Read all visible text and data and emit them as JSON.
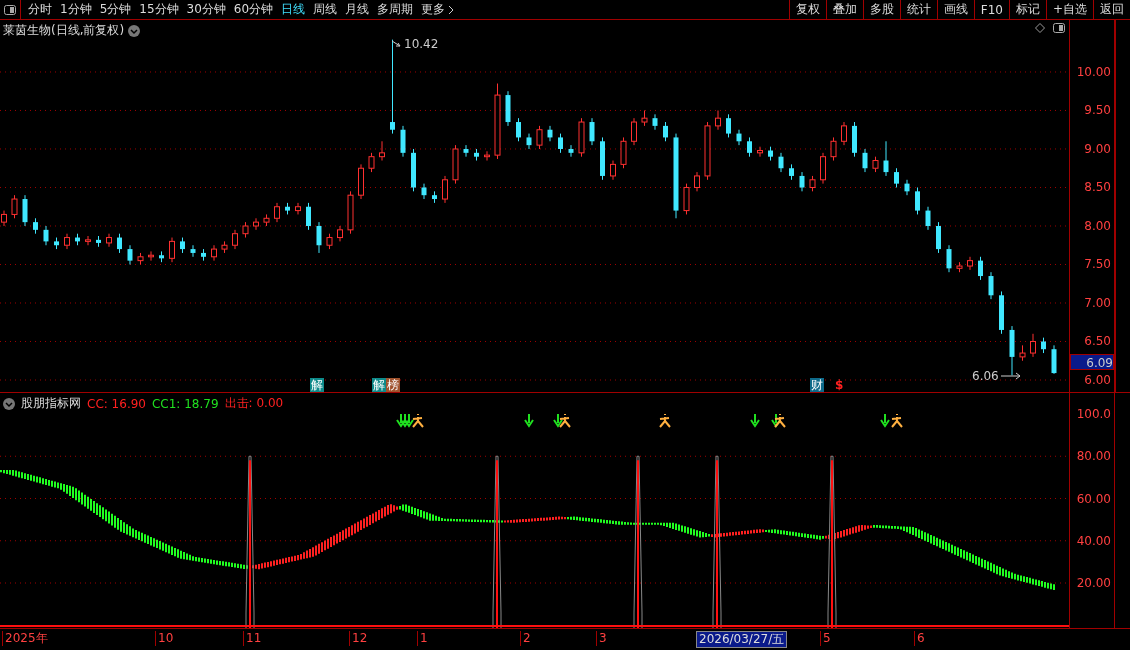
{
  "toolbar": {
    "periods": [
      {
        "label": "分时",
        "selected": false
      },
      {
        "label": "1分钟",
        "selected": false
      },
      {
        "label": "5分钟",
        "selected": false
      },
      {
        "label": "15分钟",
        "selected": false
      },
      {
        "label": "30分钟",
        "selected": false
      },
      {
        "label": "60分钟",
        "selected": false
      },
      {
        "label": "日线",
        "selected": true
      },
      {
        "label": "周线",
        "selected": false
      },
      {
        "label": "月线",
        "selected": false
      },
      {
        "label": "多周期",
        "selected": false
      },
      {
        "label": "更多",
        "selected": false
      }
    ],
    "actions": [
      "复权",
      "叠加",
      "多股",
      "统计",
      "画线",
      "F10",
      "标记",
      "+自选",
      "返回"
    ]
  },
  "main_chart": {
    "title": "莱茵生物(日线,前复权)",
    "high_label": "10.42",
    "low_label": "6.06",
    "last_price": "6.09",
    "chart_data": {
      "type": "candlestick",
      "grid": true,
      "ylim": [
        6,
        10.675
      ],
      "yticks": [
        {
          "value": 10,
          "label": "10.00"
        },
        {
          "value": 9.5,
          "label": "9.50"
        },
        {
          "value": 9,
          "label": "9.00"
        },
        {
          "value": 8.5,
          "label": "8.50"
        },
        {
          "value": 8,
          "label": "8.00"
        },
        {
          "value": 7.5,
          "label": "7.50"
        },
        {
          "value": 7,
          "label": "7.00"
        },
        {
          "value": 6.5,
          "label": "6.50"
        },
        {
          "value": 6,
          "label": "6.00"
        }
      ],
      "ohlc": [
        [
          8.05,
          8.2,
          8.0,
          8.15
        ],
        [
          8.15,
          8.4,
          8.1,
          8.35
        ],
        [
          8.35,
          8.4,
          8.0,
          8.05
        ],
        [
          8.05,
          8.1,
          7.9,
          7.95
        ],
        [
          7.95,
          8.0,
          7.75,
          7.8
        ],
        [
          7.8,
          7.85,
          7.7,
          7.75
        ],
        [
          7.75,
          7.9,
          7.7,
          7.85
        ],
        [
          7.85,
          7.9,
          7.75,
          7.8
        ],
        [
          7.8,
          7.87,
          7.75,
          7.82
        ],
        [
          7.82,
          7.87,
          7.73,
          7.78
        ],
        [
          7.78,
          7.9,
          7.73,
          7.85
        ],
        [
          7.85,
          7.9,
          7.65,
          7.7
        ],
        [
          7.7,
          7.75,
          7.5,
          7.55
        ],
        [
          7.55,
          7.65,
          7.5,
          7.6
        ],
        [
          7.6,
          7.67,
          7.55,
          7.62
        ],
        [
          7.62,
          7.67,
          7.53,
          7.58
        ],
        [
          7.58,
          7.85,
          7.53,
          7.8
        ],
        [
          7.8,
          7.85,
          7.65,
          7.7
        ],
        [
          7.7,
          7.75,
          7.6,
          7.65
        ],
        [
          7.65,
          7.7,
          7.55,
          7.6
        ],
        [
          7.6,
          7.75,
          7.55,
          7.7
        ],
        [
          7.7,
          7.8,
          7.65,
          7.75
        ],
        [
          7.75,
          7.95,
          7.7,
          7.9
        ],
        [
          7.9,
          8.05,
          7.85,
          8.0
        ],
        [
          8.0,
          8.1,
          7.95,
          8.05
        ],
        [
          8.05,
          8.15,
          8.0,
          8.1
        ],
        [
          8.1,
          8.3,
          8.05,
          8.25
        ],
        [
          8.25,
          8.3,
          8.15,
          8.2
        ],
        [
          8.2,
          8.3,
          8.15,
          8.25
        ],
        [
          8.25,
          8.3,
          7.95,
          8.0
        ],
        [
          8.0,
          8.05,
          7.65,
          7.75
        ],
        [
          7.75,
          7.9,
          7.7,
          7.85
        ],
        [
          7.85,
          8.0,
          7.8,
          7.95
        ],
        [
          7.95,
          8.45,
          7.9,
          8.4
        ],
        [
          8.4,
          8.8,
          8.35,
          8.75
        ],
        [
          8.75,
          8.95,
          8.7,
          8.9
        ],
        [
          8.9,
          9.1,
          8.85,
          8.95
        ],
        [
          9.35,
          10.42,
          9.2,
          9.25
        ],
        [
          9.25,
          9.3,
          8.9,
          8.95
        ],
        [
          8.95,
          9.0,
          8.45,
          8.5
        ],
        [
          8.5,
          8.55,
          8.35,
          8.4
        ],
        [
          8.4,
          8.45,
          8.3,
          8.35
        ],
        [
          8.35,
          8.65,
          8.3,
          8.6
        ],
        [
          8.6,
          9.05,
          8.55,
          9.0
        ],
        [
          9.0,
          9.05,
          8.9,
          8.95
        ],
        [
          8.95,
          9.0,
          8.85,
          8.9
        ],
        [
          8.9,
          8.97,
          8.85,
          8.92
        ],
        [
          8.92,
          9.85,
          8.87,
          9.7
        ],
        [
          9.7,
          9.75,
          9.3,
          9.35
        ],
        [
          9.35,
          9.4,
          9.1,
          9.15
        ],
        [
          9.15,
          9.2,
          9.0,
          9.05
        ],
        [
          9.05,
          9.3,
          9.0,
          9.25
        ],
        [
          9.25,
          9.3,
          9.1,
          9.15
        ],
        [
          9.15,
          9.2,
          8.95,
          9.0
        ],
        [
          9.0,
          9.05,
          8.9,
          8.95
        ],
        [
          8.95,
          9.4,
          8.9,
          9.35
        ],
        [
          9.35,
          9.4,
          9.05,
          9.1
        ],
        [
          9.1,
          9.15,
          8.6,
          8.65
        ],
        [
          8.65,
          8.85,
          8.6,
          8.8
        ],
        [
          8.8,
          9.15,
          8.75,
          9.1
        ],
        [
          9.1,
          9.4,
          9.05,
          9.35
        ],
        [
          9.35,
          9.5,
          9.3,
          9.4
        ],
        [
          9.4,
          9.45,
          9.25,
          9.3
        ],
        [
          9.3,
          9.35,
          9.1,
          9.15
        ],
        [
          9.15,
          9.2,
          8.1,
          8.2
        ],
        [
          8.2,
          8.55,
          8.15,
          8.5
        ],
        [
          8.5,
          8.7,
          8.45,
          8.65
        ],
        [
          8.65,
          9.35,
          8.6,
          9.3
        ],
        [
          9.3,
          9.5,
          9.25,
          9.4
        ],
        [
          9.4,
          9.45,
          9.15,
          9.2
        ],
        [
          9.2,
          9.25,
          9.05,
          9.1
        ],
        [
          9.1,
          9.15,
          8.9,
          8.95
        ],
        [
          8.95,
          9.03,
          8.9,
          8.98
        ],
        [
          8.98,
          9.03,
          8.85,
          8.9
        ],
        [
          8.9,
          8.95,
          8.7,
          8.75
        ],
        [
          8.75,
          8.8,
          8.6,
          8.65
        ],
        [
          8.65,
          8.7,
          8.45,
          8.5
        ],
        [
          8.5,
          8.65,
          8.45,
          8.6
        ],
        [
          8.6,
          8.95,
          8.55,
          8.9
        ],
        [
          8.9,
          9.15,
          8.85,
          9.1
        ],
        [
          9.1,
          9.35,
          9.05,
          9.3
        ],
        [
          9.3,
          9.35,
          8.9,
          8.95
        ],
        [
          8.95,
          9.0,
          8.7,
          8.75
        ],
        [
          8.75,
          8.9,
          8.7,
          8.85
        ],
        [
          8.85,
          9.1,
          8.65,
          8.7
        ],
        [
          8.7,
          8.75,
          8.5,
          8.55
        ],
        [
          8.55,
          8.6,
          8.4,
          8.45
        ],
        [
          8.45,
          8.5,
          8.15,
          8.2
        ],
        [
          8.2,
          8.25,
          7.95,
          8.0
        ],
        [
          8.0,
          8.05,
          7.65,
          7.7
        ],
        [
          7.7,
          7.75,
          7.4,
          7.45
        ],
        [
          7.45,
          7.53,
          7.4,
          7.48
        ],
        [
          7.48,
          7.6,
          7.43,
          7.55
        ],
        [
          7.55,
          7.6,
          7.3,
          7.35
        ],
        [
          7.35,
          7.4,
          7.05,
          7.1
        ],
        [
          7.1,
          7.15,
          6.6,
          6.65
        ],
        [
          6.65,
          6.7,
          6.06,
          6.3
        ],
        [
          6.3,
          6.45,
          6.25,
          6.35
        ],
        [
          6.35,
          6.6,
          6.3,
          6.5
        ],
        [
          6.5,
          6.55,
          6.35,
          6.4
        ],
        [
          6.4,
          6.45,
          6.08,
          6.09
        ]
      ]
    },
    "markers": [
      {
        "kind": "tag",
        "text": "解",
        "color": "#0e8a8a"
      },
      {
        "kind": "tag",
        "text": "解",
        "color": "#0e8a8a"
      },
      {
        "kind": "tag",
        "text": "榜",
        "color": "#a0522d"
      },
      {
        "kind": "tag",
        "text": "财",
        "color": "#0e6a8a"
      },
      {
        "kind": "glyph",
        "text": "$",
        "color": "#ff2020"
      }
    ]
  },
  "indicator": {
    "name": "股朋指标网",
    "values": [
      {
        "text": "CC: 16.90",
        "color": "#ff2020"
      },
      {
        "text": "CC1: 18.79",
        "color": "#20e020"
      },
      {
        "text": "出击: 0.00",
        "color": "#ff2020"
      }
    ],
    "axis": [
      "100.0",
      "80.00",
      "60.00",
      "40.00",
      "20.00"
    ]
  },
  "date_axis": [
    {
      "label": "2025年",
      "selected": false
    },
    {
      "label": "10",
      "selected": false
    },
    {
      "label": "11",
      "selected": false
    },
    {
      "label": "12",
      "selected": false
    },
    {
      "label": "1",
      "selected": false
    },
    {
      "label": "2",
      "selected": false
    },
    {
      "label": "3",
      "selected": false
    },
    {
      "label": "2026/03/27/五",
      "selected": true
    },
    {
      "label": "5",
      "selected": false
    },
    {
      "label": "6",
      "selected": false
    }
  ]
}
